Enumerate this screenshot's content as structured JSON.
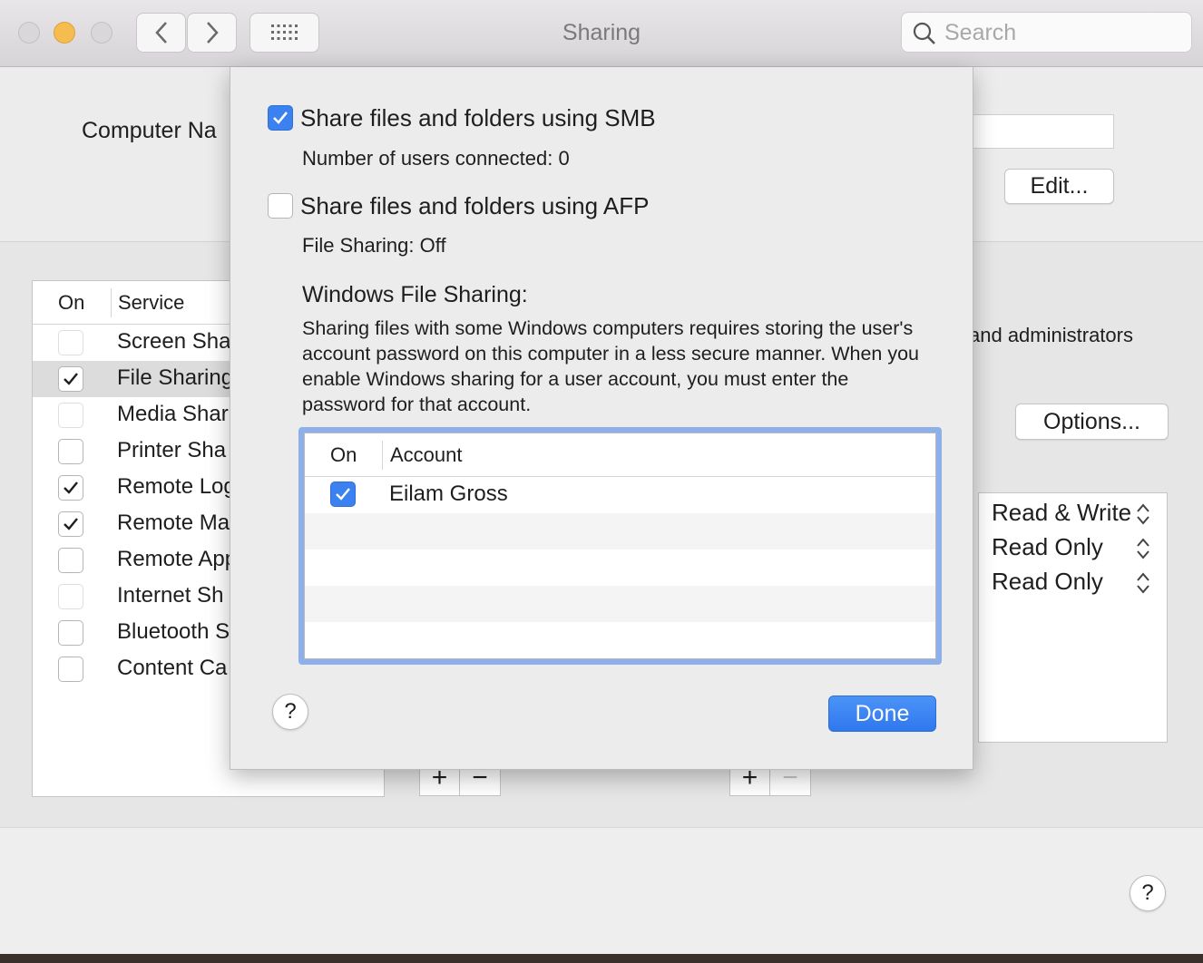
{
  "window": {
    "title": "Sharing",
    "search_placeholder": "Search"
  },
  "background": {
    "computer_name_label": "Computer Na",
    "edit_button": "Edit...",
    "options_button": "Options...",
    "access_note": "and administrators",
    "service_table": {
      "col_on": "On",
      "col_service": "Service",
      "rows": [
        {
          "label": "Screen Sha",
          "checked": false,
          "faded": true
        },
        {
          "label": "File Sharing",
          "checked": true,
          "selected": true
        },
        {
          "label": "Media Shar",
          "checked": false,
          "faded": true
        },
        {
          "label": "Printer Sha",
          "checked": false
        },
        {
          "label": "Remote Log",
          "checked": true
        },
        {
          "label": "Remote Ma",
          "checked": true
        },
        {
          "label": "Remote App",
          "checked": false
        },
        {
          "label": "Internet Sh",
          "checked": false,
          "faded": true
        },
        {
          "label": "Bluetooth S",
          "checked": false
        },
        {
          "label": "Content Ca",
          "checked": false
        }
      ]
    },
    "permissions": [
      "Read & Write",
      "Read Only",
      "Read Only"
    ],
    "plus": "+",
    "minus": "−",
    "help": "?"
  },
  "sheet": {
    "smb_label": "Share files and folders using SMB",
    "smb_checked": true,
    "smb_status": "Number of users connected: 0",
    "afp_label": "Share files and folders using AFP",
    "afp_checked": false,
    "afp_status": "File Sharing: Off",
    "windows_heading": "Windows File Sharing:",
    "windows_desc": "Sharing files with some Windows computers requires storing the user's account password on this computer in a less secure manner. When you enable Windows sharing for a user account, you must enter the password for that account.",
    "accounts": {
      "col_on": "On",
      "col_account": "Account",
      "rows": [
        {
          "name": "Eilam Gross",
          "checked": true
        }
      ]
    },
    "help": "?",
    "done_button": "Done"
  },
  "colors": {
    "accent": "#3b82f0",
    "focus_ring": "#8db0ea"
  }
}
